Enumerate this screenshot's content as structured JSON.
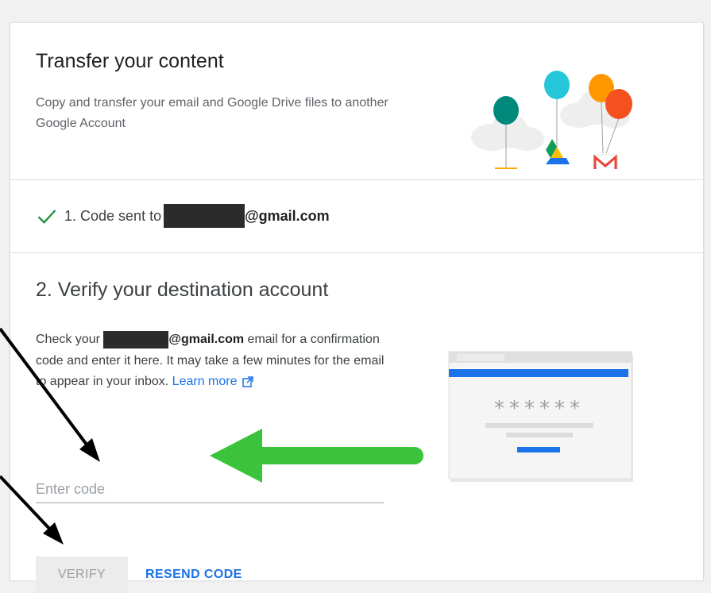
{
  "transfer": {
    "title": "Transfer your content",
    "description": "Copy and transfer your email and Google Drive files to another Google Account"
  },
  "step1": {
    "prefix": "1. Code sent to",
    "email_suffix": "@gmail.com"
  },
  "step2": {
    "title": "2. Verify your destination account",
    "text_before": "Check your ",
    "email_suffix": "@gmail.com",
    "text_after": " email for a confirmation code and enter it here. It may take a few minutes for the email to appear in your inbox. ",
    "learn_more": "Learn more",
    "code_placeholder": "Enter code",
    "code_value": "",
    "mock_code": "******",
    "verify_label": "VERIFY",
    "resend_label": "RESEND CODE"
  },
  "colors": {
    "accent_blue": "#1a73e8",
    "check_green": "#1e8e3e",
    "annotation_green": "#3bc43b"
  }
}
